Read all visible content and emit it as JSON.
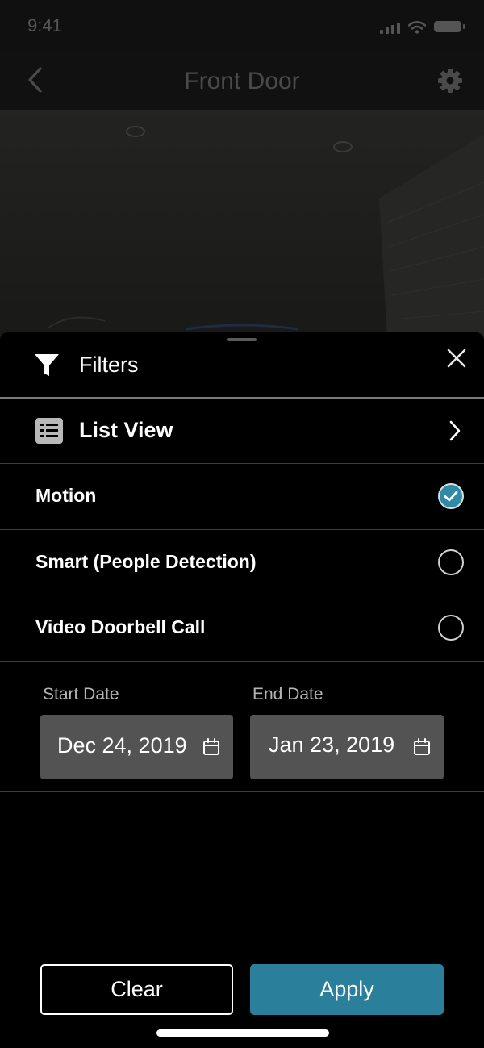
{
  "status_bar": {
    "time": "9:41"
  },
  "nav": {
    "title": "Front Door",
    "back_icon": "chevron-left-icon",
    "settings_icon": "gear-icon"
  },
  "sheet": {
    "header": {
      "title": "Filters",
      "icon": "filter-icon",
      "close_icon": "close-icon"
    },
    "list_view": {
      "label": "List View",
      "icon": "list-icon",
      "chevron": "chevron-right-icon"
    },
    "options": [
      {
        "label": "Motion",
        "checked": true
      },
      {
        "label": "Smart (People Detection)",
        "checked": false
      },
      {
        "label": "Video Doorbell Call",
        "checked": false
      }
    ],
    "dates": {
      "start_label": "Start Date",
      "start_value": "Dec 24, 2019",
      "end_label": "End Date",
      "end_value": "Jan 23, 2019"
    },
    "buttons": {
      "clear": "Clear",
      "apply": "Apply"
    }
  },
  "colors": {
    "accent": "#2a7f9b",
    "check": "#2f8aa8",
    "field_bg": "#535353",
    "sheet_bg": "#000000"
  }
}
